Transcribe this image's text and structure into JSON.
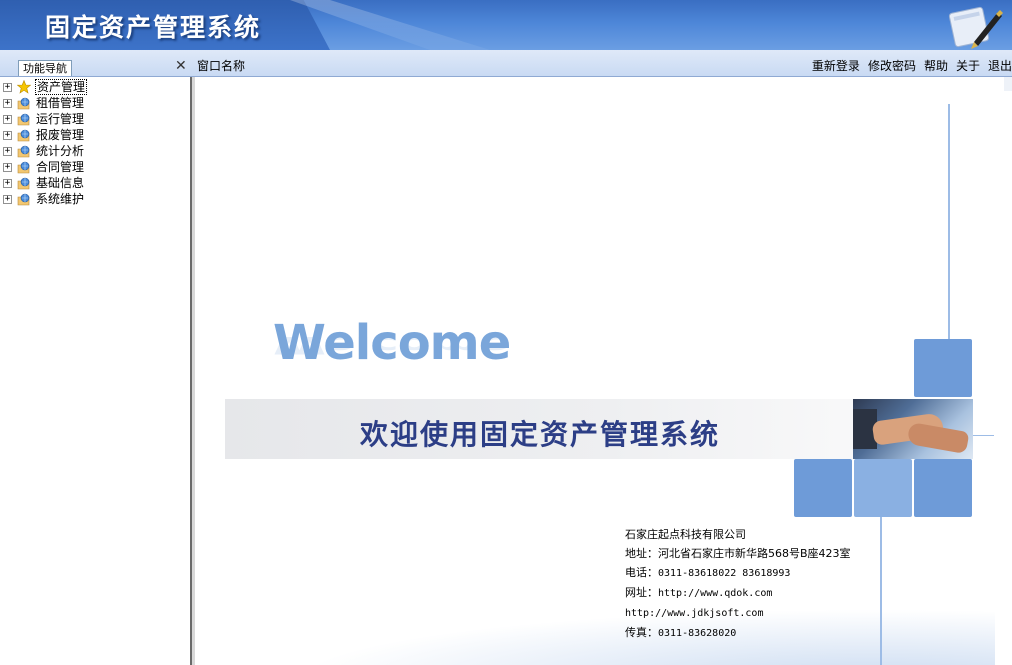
{
  "header": {
    "title": "固定资产管理系统"
  },
  "toolbar": {
    "nav_tab": "功能导航",
    "close_glyph": "✕",
    "window_label": "窗口名称",
    "links": {
      "relogin": "重新登录",
      "change_password": "修改密码",
      "help": "帮助",
      "about": "关于",
      "exit": "退出"
    }
  },
  "sidebar": {
    "items": [
      {
        "label": "资产管理",
        "icon": "star-icon",
        "selected": true
      },
      {
        "label": "租借管理",
        "icon": "folder-globe-icon"
      },
      {
        "label": "运行管理",
        "icon": "folder-globe-icon"
      },
      {
        "label": "报废管理",
        "icon": "folder-globe-icon"
      },
      {
        "label": "统计分析",
        "icon": "folder-globe-icon"
      },
      {
        "label": "合同管理",
        "icon": "folder-globe-icon"
      },
      {
        "label": "基础信息",
        "icon": "folder-globe-icon"
      },
      {
        "label": "系统维护",
        "icon": "folder-globe-icon"
      }
    ],
    "expander": "+"
  },
  "main": {
    "welcome": "Welcome",
    "banner": "欢迎使用固定资产管理系统",
    "company": {
      "name": "石家庄起点科技有限公司",
      "address": "地址：河北省石家庄市新华路568号B座423室",
      "phone_label": "电话：",
      "phone": "0311-83618022  83618993",
      "website_label": "网址：",
      "website1": "http://www.qdok.com",
      "website2": "http://www.jdkjsoft.com",
      "fax_label": "传真：",
      "fax": "0311-83628020"
    }
  },
  "colors": {
    "header_blue": "#4d86d8",
    "tile_blue": "#6e9bd8",
    "banner_text": "#2c3e86"
  }
}
